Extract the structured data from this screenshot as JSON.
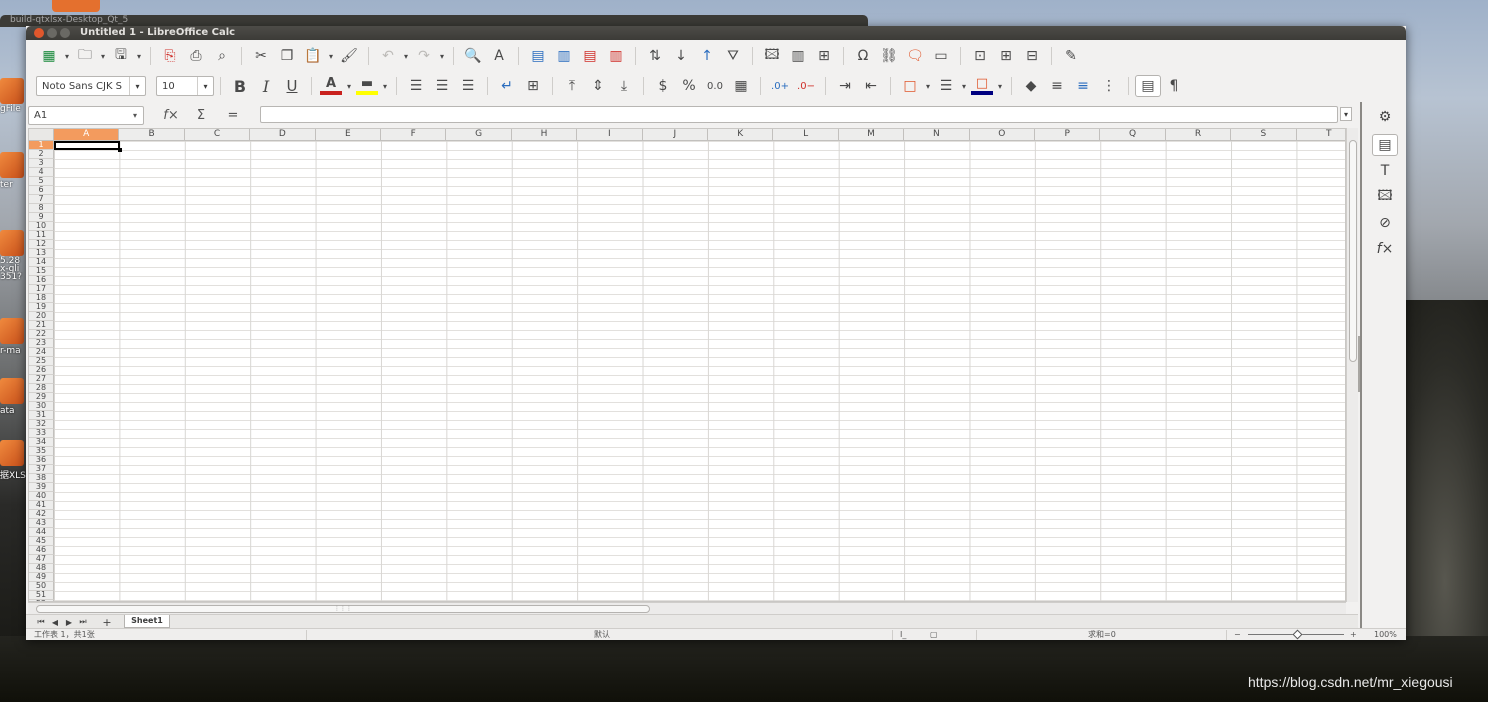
{
  "window": {
    "title": "Untitled 1 - LibreOffice Calc"
  },
  "background_window": {
    "title": "build-qtxlsx-Desktop_Qt_5"
  },
  "launcher": {
    "labels": [
      "gFile",
      "ter",
      "5.28",
      "x-gli",
      "351?",
      "r-ma",
      "ata",
      "据XLS"
    ]
  },
  "watermark": "https://blog.csdn.net/mr_xiegousi",
  "toolbar2": {
    "font_name": "Noto Sans CJK S",
    "font_size": "10"
  },
  "formula_bar": {
    "cell_ref": "A1",
    "formula": ""
  },
  "columns": [
    "A",
    "B",
    "C",
    "D",
    "E",
    "F",
    "G",
    "H",
    "I",
    "J",
    "K",
    "L",
    "M",
    "N",
    "O",
    "P",
    "Q",
    "R",
    "S",
    "T"
  ],
  "rows": [
    "1",
    "2",
    "3",
    "4",
    "5",
    "6",
    "7",
    "8",
    "9",
    "10",
    "11",
    "12",
    "13",
    "14",
    "15",
    "16",
    "17",
    "18",
    "19",
    "20",
    "21",
    "22",
    "23",
    "24",
    "25",
    "26",
    "27",
    "28",
    "29",
    "30",
    "31",
    "32",
    "33",
    "34",
    "35",
    "36",
    "37",
    "38",
    "39",
    "40",
    "41",
    "42",
    "43",
    "44",
    "45",
    "46",
    "47",
    "48",
    "49",
    "50",
    "51",
    "52"
  ],
  "selected_cell": "A1",
  "sheets": [
    "Sheet1"
  ],
  "status": {
    "sheet_info": "工作表 1，共1张",
    "page_style": "默认",
    "sum": "求和=0",
    "zoom": "100%",
    "zoom_minus": "−",
    "zoom_plus": "+"
  },
  "colors": {
    "accent": "#e0572c",
    "header_selected": "#f39b5e",
    "font_color_bar": "#c9211e",
    "highlight_bar": "#ffff00",
    "border_color_bar": "#000080"
  }
}
